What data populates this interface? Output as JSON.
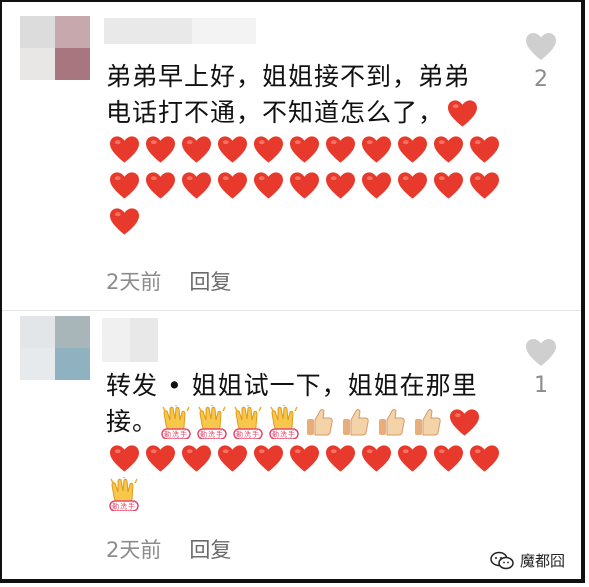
{
  "comments": [
    {
      "text_lines": [
        "弟弟早上好，姐姐接不到，弟弟",
        "电话打不通，不知道怎么了，"
      ],
      "time": "2天前",
      "reply_label": "回复",
      "likes": "2",
      "like_icon": "heart-icon",
      "emoji_name": "red-heart",
      "heart_count": 23
    },
    {
      "text_lines": [
        "转发 • 姐姐试一下，姐姐在那里",
        "接。"
      ],
      "time": "2天前",
      "reply_label": "回复",
      "likes": "1",
      "like_icon": "heart-icon",
      "clap_badge": "勤洗手",
      "heart_count": 12,
      "thumb_count": 4,
      "clap_count": 5
    }
  ],
  "watermark": {
    "text": "魔都囧",
    "icon": "wechat-icon"
  },
  "colors": {
    "heart": "#e83a2c",
    "like_gray": "#cfcfcf",
    "meta_gray": "#8c8c8c"
  }
}
